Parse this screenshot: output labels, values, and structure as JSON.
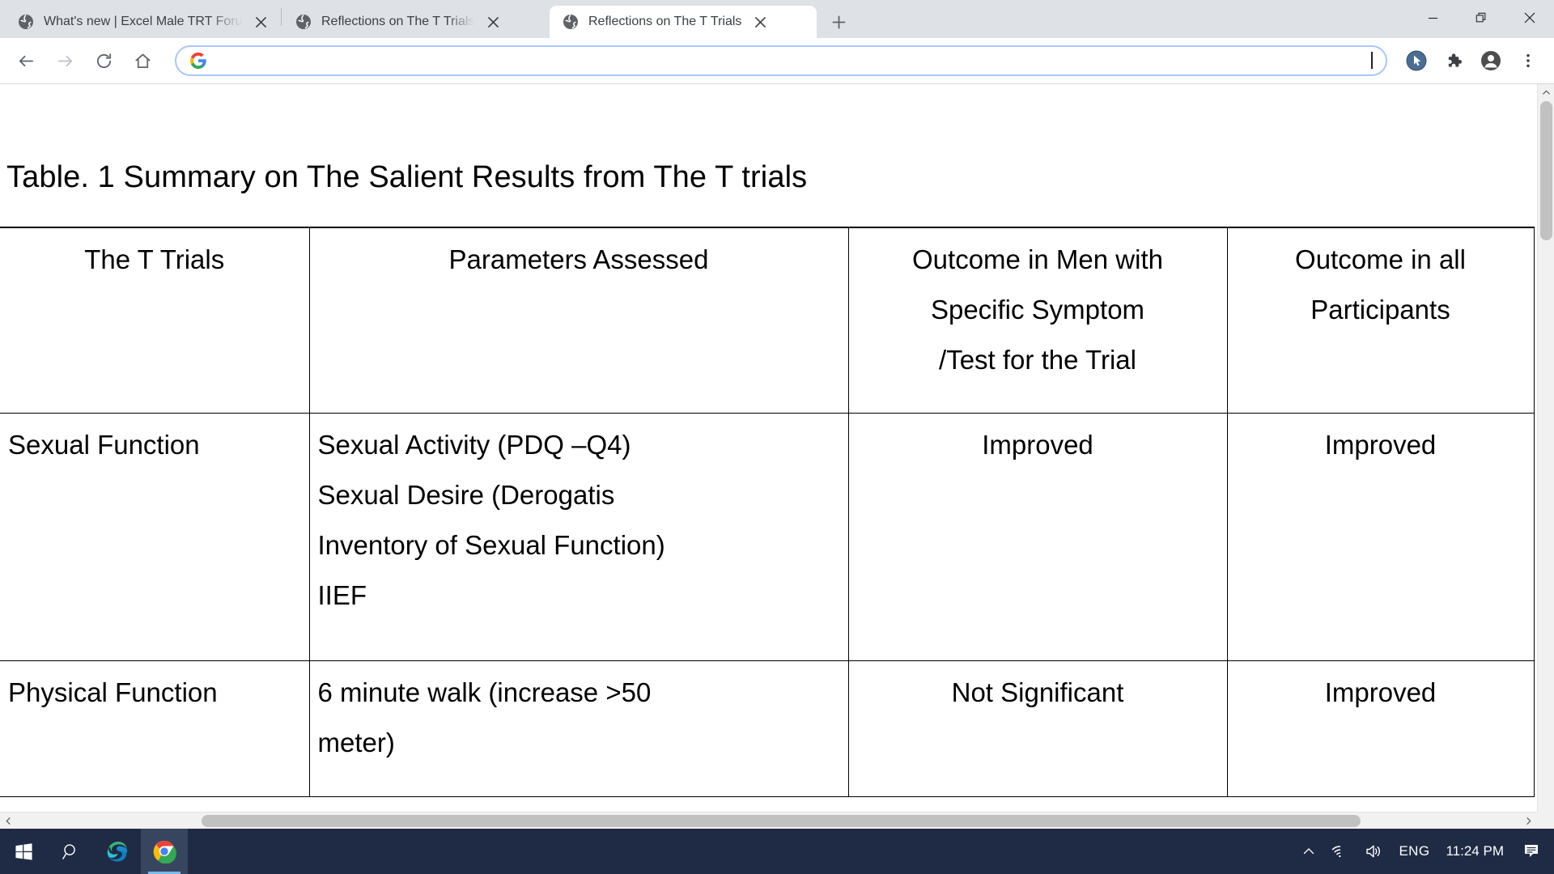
{
  "browser": {
    "tabs": [
      {
        "title": "What's new | Excel Male TRT Foru",
        "favicon": "globe-icon",
        "active": false,
        "closable": true
      },
      {
        "title": "Reflections on The T Trials",
        "favicon": "globe-icon",
        "active": false,
        "closable": true
      },
      {
        "title": "Reflections on The T Trials",
        "favicon": "globe-icon",
        "active": true,
        "closable": true
      }
    ],
    "new_tab_label": "+",
    "window_controls": {
      "minimize": "minimize-icon",
      "restore": "restore-icon",
      "close": "close-icon"
    },
    "toolbar": {
      "back": "back-arrow-icon",
      "forward": "forward-arrow-icon",
      "reload": "reload-icon",
      "home": "home-icon",
      "omnibox_value": "",
      "omnibox_icon": "google-g-icon",
      "right_icons": [
        "cursor-pointer-icon",
        "extensions-puzzle-icon",
        "profile-avatar-icon",
        "chrome-menu-icon"
      ]
    }
  },
  "page": {
    "title": "Table. 1 Summary on The Salient Results from The T trials",
    "table": {
      "headers": {
        "trial": "The T Trials",
        "parameters": "Parameters Assessed",
        "specific": [
          "Outcome in Men with",
          "Specific Symptom",
          "/Test for the Trial"
        ],
        "all": [
          "Outcome in all",
          "Participants"
        ]
      },
      "rows": [
        {
          "trial": "Sexual Function",
          "parameters": [
            "Sexual Activity (PDQ –Q4)",
            "Sexual Desire (Derogatis",
            "Inventory of Sexual Function)",
            "IIEF"
          ],
          "specific": "Improved",
          "all": "Improved"
        },
        {
          "trial": "Physical Function",
          "parameters": [
            "6 minute walk (increase >50",
            "meter)"
          ],
          "specific": "Not Significant",
          "all": "Improved"
        }
      ]
    }
  },
  "taskbar": {
    "start": "windows-start-icon",
    "search": "search-icon",
    "apps": [
      "edge-icon",
      "chrome-icon"
    ],
    "tray": {
      "overflow": "chevron-up-icon",
      "network": "wifi-icon",
      "volume": "speaker-icon",
      "language": "ENG",
      "clock": "11:24 PM",
      "notifications": "notification-icon"
    }
  },
  "colors": {
    "tab_strip_bg": "#dee1e6",
    "toolbar_bg": "#ffffff",
    "omnibox_border": "#a8c7fa",
    "taskbar_bg": "#1f2b44",
    "taskbar_active": "#38455f",
    "taskbar_indicator": "#76b9ed",
    "page_text": "#000000"
  }
}
